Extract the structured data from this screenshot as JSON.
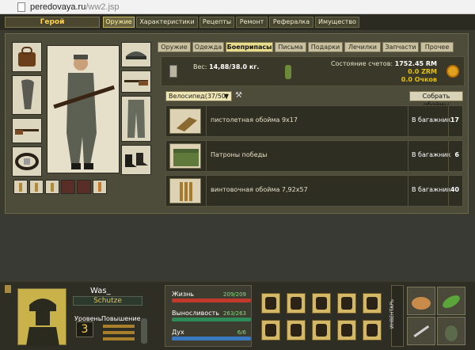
{
  "browser": {
    "url_host": "peredovaya.ru",
    "url_path": "/ww2.jsp"
  },
  "topnav": {
    "hero": "Герой",
    "tabs": [
      {
        "label": "Оружие",
        "active": true
      },
      {
        "label": "Характеристики",
        "active": false
      },
      {
        "label": "Рецепты",
        "active": false
      },
      {
        "label": "Ремонт",
        "active": false
      },
      {
        "label": "Рефералка",
        "active": false
      },
      {
        "label": "Имущество",
        "active": false
      }
    ]
  },
  "subtabs": [
    {
      "label": "Оружие",
      "active": false
    },
    {
      "label": "Одежда",
      "active": false
    },
    {
      "label": "Боеприпасы",
      "active": true
    },
    {
      "label": "Письма",
      "active": false
    },
    {
      "label": "Подарки",
      "active": false
    },
    {
      "label": "Лечилки",
      "active": false
    },
    {
      "label": "Запчасти",
      "active": false
    },
    {
      "label": "Прочее",
      "active": false
    }
  ],
  "weight": {
    "label": "Вес:",
    "value": "14,88/38.0 кг."
  },
  "accounts": {
    "label": "Состояние счетов:",
    "rm": "1752.45 RM",
    "zrm": "0.0 ZRM",
    "points": "0.0 Очков"
  },
  "filter": {
    "selected": "Велосипед(37/50)",
    "collect_button": "Собрать обоймы"
  },
  "ammo": [
    {
      "name": "пистолетная обойма 9х17",
      "location": "В багажник",
      "qty": "17",
      "icon": "pistol-clip-icon"
    },
    {
      "name": "Патроны победы",
      "location": "В багажник",
      "qty": "6",
      "icon": "ammo-crate-icon"
    },
    {
      "name": "винтовочная обойма 7,92х57",
      "location": "В багажник",
      "qty": "40",
      "icon": "rifle-clip-icon"
    }
  ],
  "player": {
    "name": "Was_",
    "rank": "Schutze",
    "level_label": "Уровень",
    "level": "3",
    "promotion_label": "Повышение"
  },
  "stats": {
    "life_label": "Жизнь",
    "life_value": "209/209",
    "stamina_label": "Выносливость",
    "stamina_value": "263/263",
    "spirit_label": "Дух",
    "spirit_value": "6/6"
  },
  "inventory_tab": "ИНВЕНТАРЬ",
  "colors": {
    "accent": "#e6c200",
    "life_bar": "#c0392b",
    "stamina_bar": "#2e8b57",
    "spirit_bar": "#3a78c0"
  }
}
